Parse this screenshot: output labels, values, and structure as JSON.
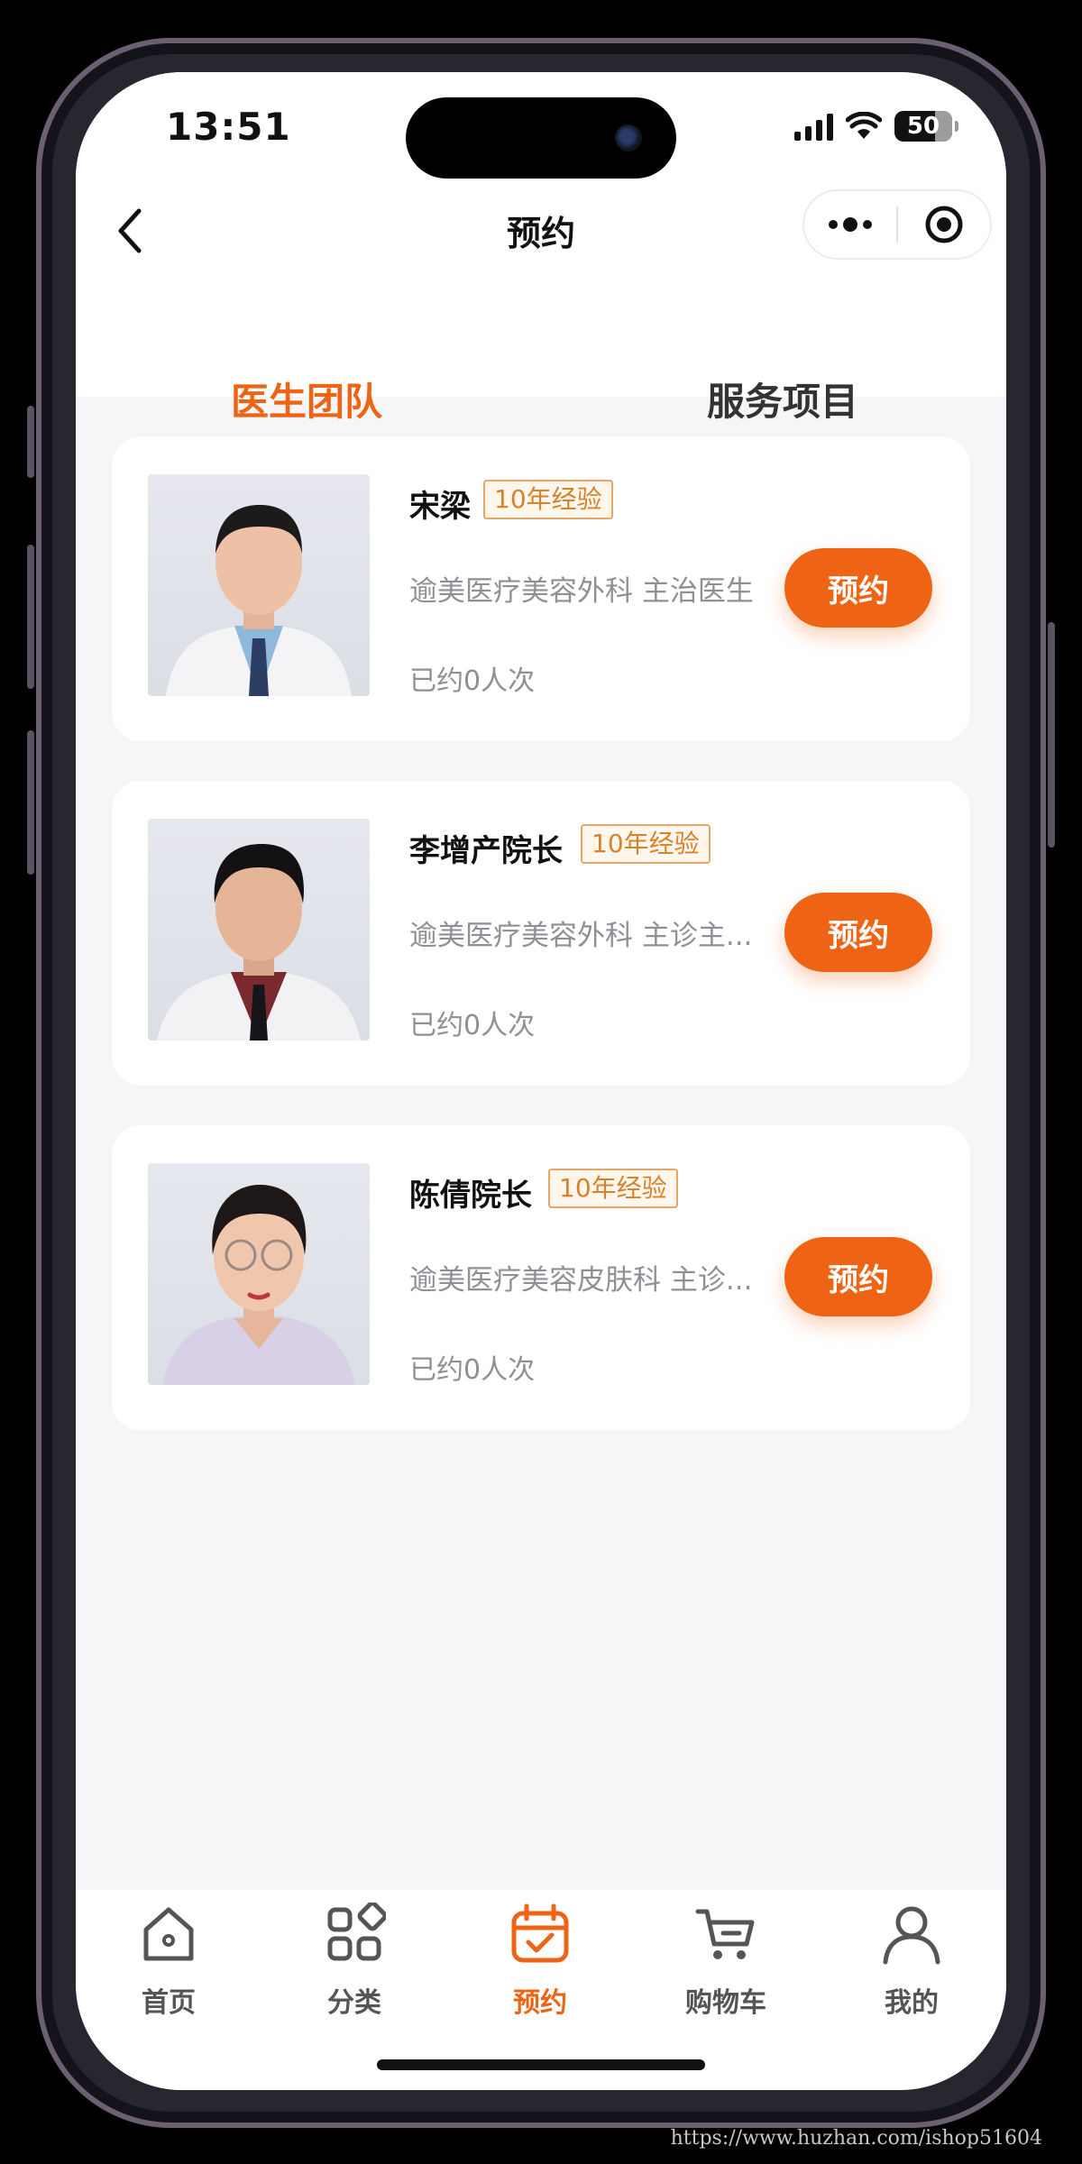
{
  "status_bar": {
    "time": "13:51",
    "battery": "50"
  },
  "nav": {
    "title": "预约"
  },
  "tabs": [
    {
      "label": "医生团队",
      "active": true
    },
    {
      "label": "服务项目",
      "active": false
    }
  ],
  "doctors": [
    {
      "name": "宋梁",
      "experience": "10年经验",
      "title": "逾美医疗美容外科 主治医生",
      "booked": "已约0人次",
      "button": "预约"
    },
    {
      "name": "李增产院长",
      "experience": "10年经验",
      "title": "逾美医疗美容外科 主诊主...",
      "booked": "已约0人次",
      "button": "预约"
    },
    {
      "name": "陈倩院长",
      "experience": "10年经验",
      "title": "逾美医疗美容皮肤科 主诊...",
      "booked": "已约0人次",
      "button": "预约"
    }
  ],
  "tabbar": [
    {
      "label": "首页",
      "icon": "home-icon",
      "active": false
    },
    {
      "label": "分类",
      "icon": "category-icon",
      "active": false
    },
    {
      "label": "预约",
      "icon": "calendar-icon",
      "active": true
    },
    {
      "label": "购物车",
      "icon": "cart-icon",
      "active": false
    },
    {
      "label": "我的",
      "icon": "user-icon",
      "active": false
    }
  ],
  "watermark": "https://www.huzhan.com/ishop51604",
  "colors": {
    "accent": "#ee6414",
    "tag_border": "#e8a566",
    "background": "#f6f6f8"
  }
}
